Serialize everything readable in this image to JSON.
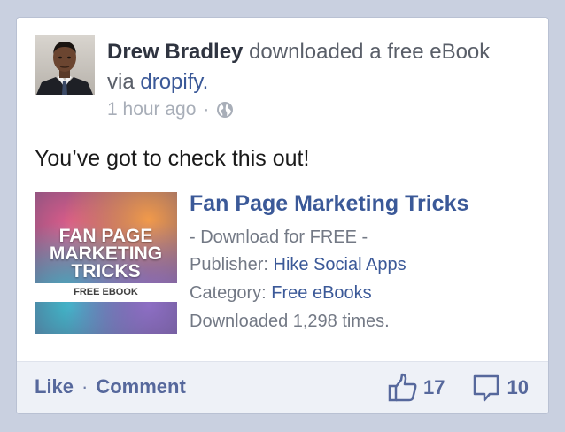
{
  "post": {
    "author": "Drew Bradley",
    "action_text": "downloaded a free eBook",
    "via_prefix": "via",
    "via_app": "dropify",
    "via_suffix": ".",
    "time": "1 hour ago",
    "time_separator": "·",
    "privacy_icon": "globe-icon",
    "status_text": "You’ve got to check this out!"
  },
  "attachment": {
    "thumbnail_title_lines": [
      "FAN PAGE",
      "MARKETING",
      "TRICKS"
    ],
    "thumbnail_badge": "FREE EBOOK",
    "title": "Fan Page Marketing Tricks",
    "subtitle": "- Download for FREE -",
    "publisher_label": "Publisher:",
    "publisher_value": "Hike Social Apps",
    "category_label": "Category:",
    "category_value": "Free eBooks",
    "downloads_text": "Downloaded 1,298 times."
  },
  "footer": {
    "like_label": "Like",
    "separator": "·",
    "comment_label": "Comment",
    "like_count": "17",
    "comment_count": "10",
    "like_icon": "thumbs-up-icon",
    "comment_icon": "speech-bubble-icon"
  },
  "colors": {
    "link": "#3b5998",
    "footer_text": "#56689c",
    "background": "#c9d0e0"
  }
}
